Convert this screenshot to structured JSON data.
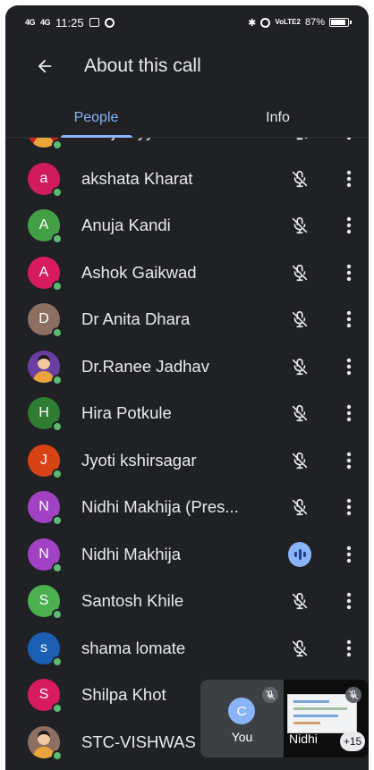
{
  "status_bar": {
    "signal1": "4G",
    "signal2": "4G",
    "time": "11:25",
    "volte": "VoLTE2",
    "battery": "87%"
  },
  "app_bar": {
    "back_icon": "arrow-back-icon",
    "title": "About this call"
  },
  "tabs": [
    {
      "label": "People",
      "active": true
    },
    {
      "label": "Info",
      "active": false
    }
  ],
  "participants": [
    {
      "name": "Afroj sayyad",
      "initial": "",
      "avatar_color": "#c5221f",
      "photo": true,
      "speaking": false
    },
    {
      "name": "akshata Kharat",
      "initial": "a",
      "avatar_color": "#d01b5c",
      "photo": false,
      "speaking": false
    },
    {
      "name": "Anuja Kandi",
      "initial": "A",
      "avatar_color": "#43a047",
      "photo": false,
      "speaking": false
    },
    {
      "name": "Ashok Gaikwad",
      "initial": "A",
      "avatar_color": "#d81b60",
      "photo": false,
      "speaking": false
    },
    {
      "name": "Dr Anita Dhara",
      "initial": "D",
      "avatar_color": "#8d6e63",
      "photo": false,
      "speaking": false
    },
    {
      "name": "Dr.Ranee Jadhav",
      "initial": "",
      "avatar_color": "#6a3fa0",
      "photo": true,
      "speaking": false
    },
    {
      "name": "Hira Potkule",
      "initial": "H",
      "avatar_color": "#2e7d32",
      "photo": false,
      "speaking": false
    },
    {
      "name": "Jyoti kshirsagar",
      "initial": "J",
      "avatar_color": "#d84315",
      "photo": false,
      "speaking": false
    },
    {
      "name": "Nidhi Makhija (Pres...",
      "initial": "N",
      "avatar_color": "#a142c4",
      "photo": false,
      "speaking": false
    },
    {
      "name": "Nidhi Makhija",
      "initial": "N",
      "avatar_color": "#a142c4",
      "photo": false,
      "speaking": true
    },
    {
      "name": "Santosh Khile",
      "initial": "S",
      "avatar_color": "#4caf50",
      "photo": false,
      "speaking": false
    },
    {
      "name": "shama lomate",
      "initial": "s",
      "avatar_color": "#1a5fb4",
      "photo": false,
      "speaking": false
    },
    {
      "name": "Shilpa Khot",
      "initial": "S",
      "avatar_color": "#d81b60",
      "photo": false,
      "speaking": false
    },
    {
      "name": "STC-VISHWAS",
      "initial": "",
      "avatar_color": "#8d6e63",
      "photo": true,
      "speaking": false
    }
  ],
  "pip": {
    "self_initial": "C",
    "self_label": "You",
    "other_label": "Nidhi",
    "others_count": "+15"
  },
  "colors": {
    "background": "#202124",
    "accent": "#8ab4f8",
    "online": "#5bb974"
  }
}
